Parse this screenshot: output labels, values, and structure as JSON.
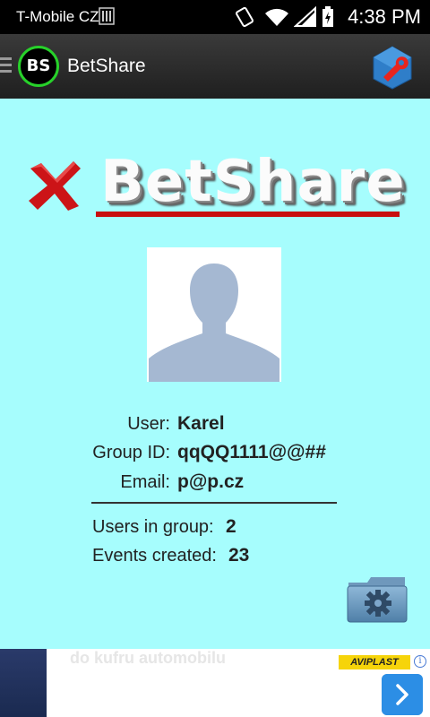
{
  "status_bar": {
    "carrier": "T-Mobile CZ",
    "time": "4:38 PM"
  },
  "action_bar": {
    "logo_text": "BS",
    "title": "BetShare"
  },
  "brand": {
    "wordmark": "BetShare"
  },
  "profile": {
    "user_label": "User:",
    "user_value": "Karel",
    "group_label": "Group ID:",
    "group_value": "qqQQ1111@@##",
    "email_label": "Email:",
    "email_value": "p@p.cz"
  },
  "stats": {
    "users_label": "Users in group:",
    "users_value": "2",
    "events_label": "Events created:",
    "events_value": "23"
  },
  "ad": {
    "headline": "do kufru automobilu",
    "brand": "AVIPLAST"
  },
  "colors": {
    "background": "#a6fdfd",
    "accent_red": "#c80e0e",
    "logo_ring": "#27d12a",
    "ad_button": "#2c8ee5"
  }
}
